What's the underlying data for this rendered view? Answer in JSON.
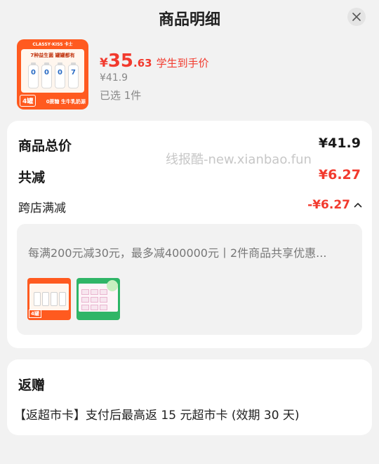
{
  "header": {
    "title": "商品明细"
  },
  "product": {
    "thumb": {
      "brand": "CLASSY·KISS 卡士",
      "headline": "7种益生菌 罐罐都有",
      "bottle_labels": [
        "0",
        "0",
        "0",
        "7"
      ],
      "badge": "4罐",
      "footer": "0蔗糖 生牛乳奶源"
    },
    "price_symbol": "¥",
    "price_integer": "35",
    "price_decimal": ".63",
    "price_tag": "学生到手价",
    "original_price": "¥41.9",
    "selected_text": "已选 1件"
  },
  "summary": {
    "total_label": "商品总价",
    "total_value": "¥41.9",
    "discount_label": "共减",
    "discount_value": "¥6.27",
    "watermark": "线报酷-new.xianbao.fun",
    "cross_store_label": "跨店满减",
    "cross_store_value": "-¥6.27",
    "promo_text": "每满200元减30元，最多减400000元丨2件商品共享优惠..."
  },
  "gift": {
    "title": "返赠",
    "text": "【返超市卡】支付后最高返 15 元超市卡 (效期 30 天)"
  },
  "colors": {
    "accent": "#f23a2e",
    "page_bg": "#f2f2f2",
    "card_bg": "#ffffff",
    "muted": "#888888"
  },
  "icons": {
    "close": "close-icon",
    "collapse": "chevron-up-icon"
  }
}
